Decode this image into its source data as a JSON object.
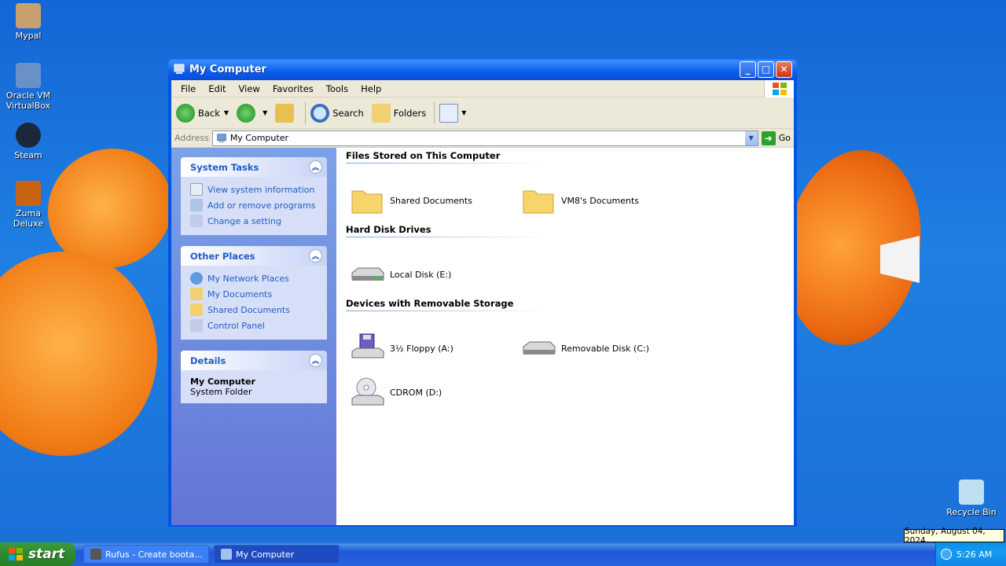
{
  "desktop": {
    "icons": [
      {
        "label": "Mypal",
        "color": "#c8a070"
      },
      {
        "label": "Oracle VM VirtualBox",
        "color": "#6a90c8"
      },
      {
        "label": "Steam",
        "color": "#1b2838"
      },
      {
        "label": "Zuma Deluxe",
        "color": "#c86414"
      },
      {
        "label": "Recycle Bin",
        "color": "#bfe0f0"
      }
    ]
  },
  "window": {
    "title": "My Computer",
    "menu": [
      "File",
      "Edit",
      "View",
      "Favorites",
      "Tools",
      "Help"
    ],
    "toolbar": {
      "back": "Back",
      "search": "Search",
      "folders": "Folders"
    },
    "address": {
      "label": "Address",
      "value": "My Computer",
      "go": "Go"
    },
    "left_pane": {
      "system_tasks": {
        "title": "System Tasks",
        "items": [
          "View system information",
          "Add or remove programs",
          "Change a setting"
        ]
      },
      "other_places": {
        "title": "Other Places",
        "items": [
          "My Network Places",
          "My Documents",
          "Shared Documents",
          "Control Panel"
        ]
      },
      "details": {
        "title": "Details",
        "name": "My Computer",
        "type": "System Folder"
      }
    },
    "groups": [
      {
        "title": "Files Stored on This Computer",
        "items": [
          {
            "label": "Shared Documents",
            "icon": "folder-icon"
          },
          {
            "label": "VM8's Documents",
            "icon": "folder-icon"
          }
        ]
      },
      {
        "title": "Hard Disk Drives",
        "items": [
          {
            "label": "Local Disk (E:)",
            "icon": "hard-disk-icon"
          }
        ]
      },
      {
        "title": "Devices with Removable Storage",
        "items": [
          {
            "label": "3½ Floppy (A:)",
            "icon": "floppy-drive-icon"
          },
          {
            "label": "Removable Disk (C:)",
            "icon": "removable-disk-icon"
          },
          {
            "label": "CDROM (D:)",
            "icon": "cdrom-icon"
          }
        ]
      }
    ]
  },
  "taskbar": {
    "start": "start",
    "tasks": [
      "Rufus - Create boota...",
      "My Computer"
    ],
    "clock": "5:26 AM",
    "tooltip": "Sunday, August 04, 2024"
  }
}
